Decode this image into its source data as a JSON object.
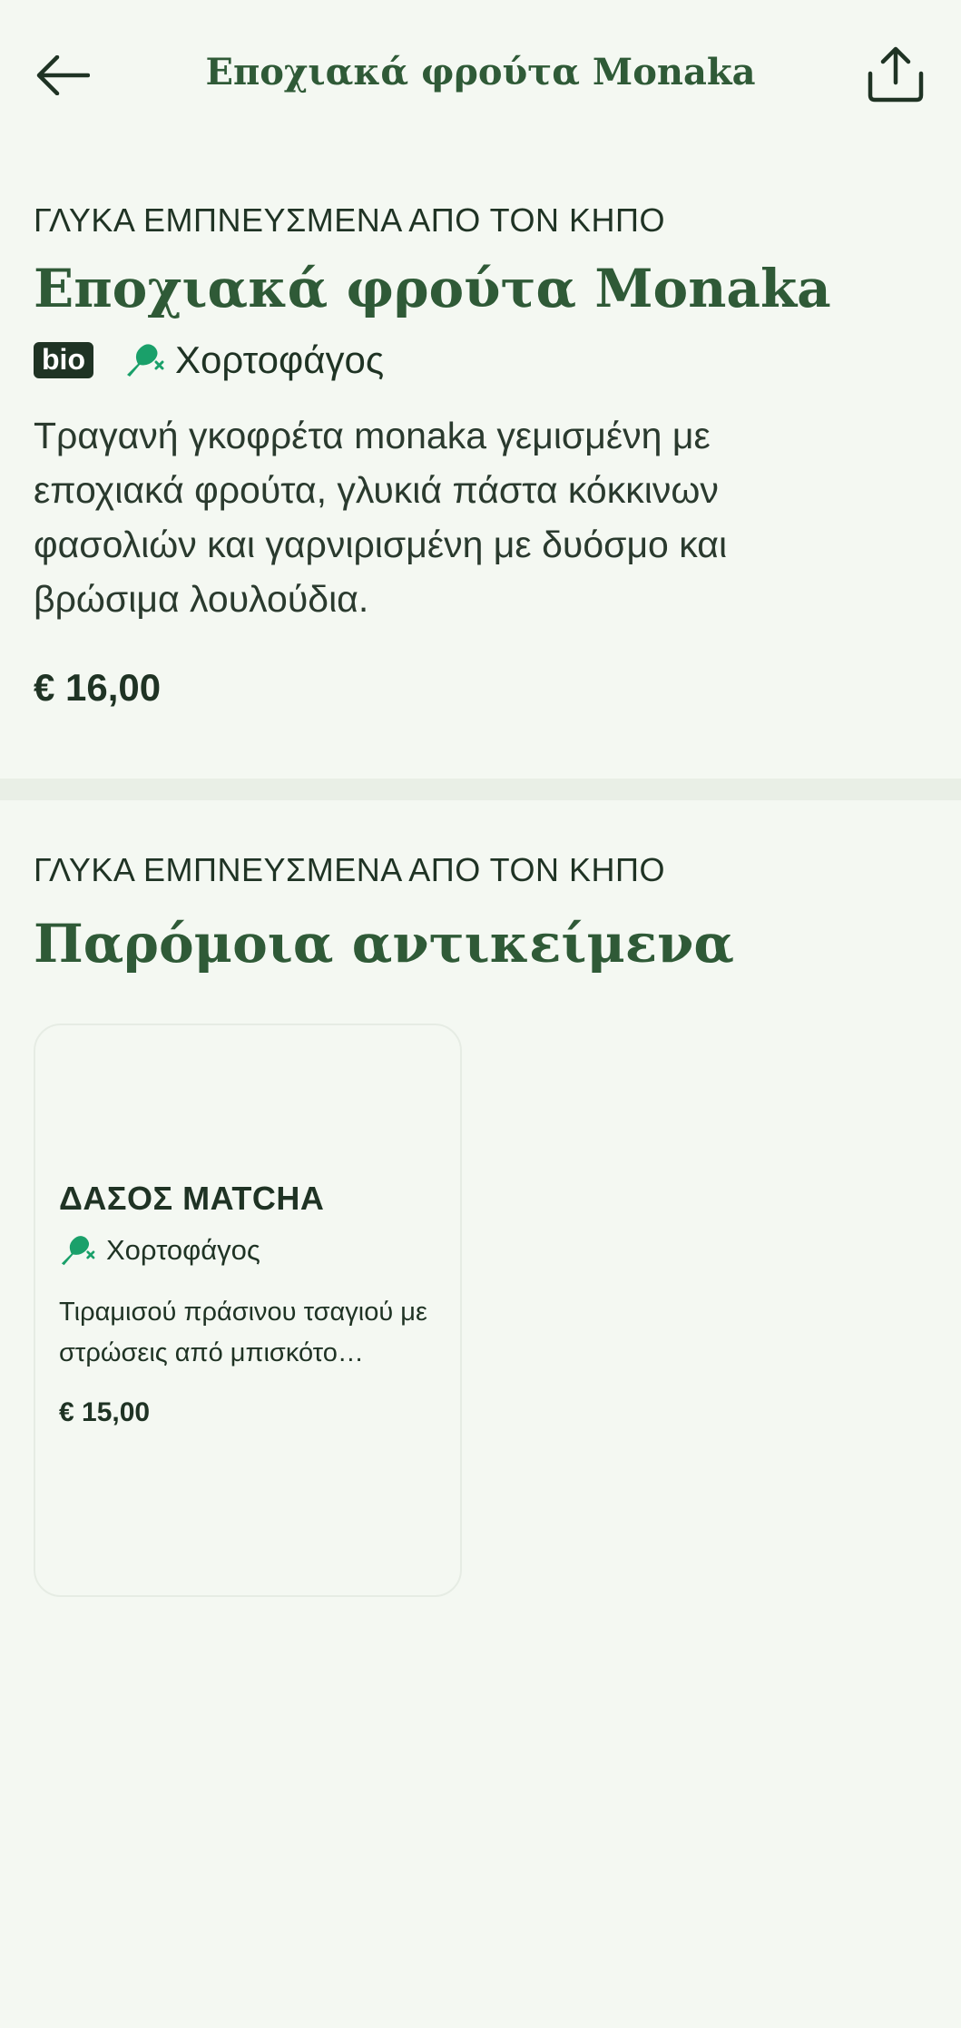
{
  "header": {
    "title": "Εποχιακά φρούτα Monaka",
    "back_icon": "arrow-left-icon",
    "share_icon": "share-icon"
  },
  "product": {
    "category": "ΓΛΥΚΑ ΕΜΠΝΕΥΣΜΕΝΑ ΑΠΟ ΤΟΝ ΚΗΠΟ",
    "title": "Εποχιακά φρούτα Monaka",
    "bio_badge": "bio",
    "diet_label": "Χορτοφάγος",
    "description": "Τραγανή γκοφρέτα monaka γεμισμένη με εποχιακά φρούτα, γλυκιά πάστα κόκκινων φασολιών και γαρνιρισμένη με δυόσμο και βρώσιμα λουλούδια.",
    "price": "€ 16,00"
  },
  "similar": {
    "category": "ΓΛΥΚΑ ΕΜΠΝΕΥΣΜΕΝΑ ΑΠΟ ΤΟΝ ΚΗΠΟ",
    "title": "Παρόμοια αντικείμενα",
    "items": [
      {
        "title": "ΔΑΣΟΣ MATCHA",
        "diet_label": "Χορτοφάγος",
        "description": "Τιραμισού πράσινου τσαγιού με στρώσεις από μπισκότο σαβαγιάρ",
        "price": "€ 15,00"
      }
    ]
  },
  "colors": {
    "background": "#f4f8f2",
    "brand_green": "#2f5a37",
    "vegetarian_icon": "#1aa06a",
    "text_dark": "#1f3324"
  }
}
